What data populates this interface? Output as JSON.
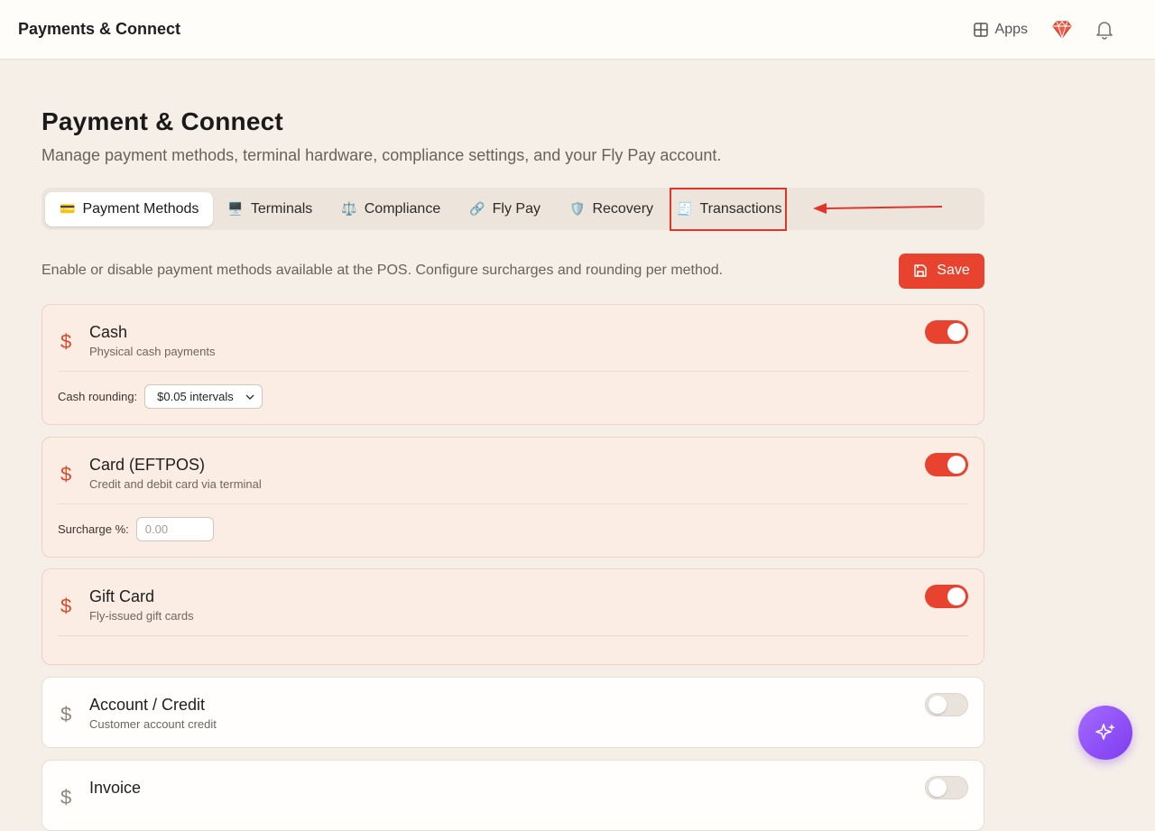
{
  "header": {
    "title": "Payments & Connect",
    "apps_label": "Apps"
  },
  "page": {
    "title": "Payment & Connect",
    "subtitle": "Manage payment methods, terminal hardware, compliance settings, and your Fly Pay account."
  },
  "tabs": [
    {
      "label": "Payment Methods",
      "emoji": "💳",
      "active": true
    },
    {
      "label": "Terminals",
      "emoji": "🖥️",
      "active": false
    },
    {
      "label": "Compliance",
      "emoji": "⚖️",
      "active": false
    },
    {
      "label": "Fly Pay",
      "emoji": "🔗",
      "active": false
    },
    {
      "label": "Recovery",
      "emoji": "🛡️",
      "active": false
    },
    {
      "label": "Transactions",
      "emoji": "🧾",
      "active": false
    }
  ],
  "intro": {
    "text": "Enable or disable payment methods available at the POS. Configure surcharges and rounding per method.",
    "save_label": "Save"
  },
  "methods": [
    {
      "name": "Cash",
      "description": "Physical cash payments",
      "enabled": true,
      "setting_label": "Cash rounding:",
      "setting_value": "$0.05 intervals"
    },
    {
      "name": "Card (EFTPOS)",
      "description": "Credit and debit card via terminal",
      "enabled": true,
      "setting_label": "Surcharge %:",
      "setting_placeholder": "0.00"
    },
    {
      "name": "Gift Card",
      "description": "Fly-issued gift cards",
      "enabled": true
    },
    {
      "name": "Account / Credit",
      "description": "Customer account credit",
      "enabled": false
    },
    {
      "name": "Invoice",
      "description": "",
      "enabled": false
    }
  ],
  "colors": {
    "accent": "#e8432f",
    "background": "#f6efe8",
    "fab_purple": "#8f4cf5"
  },
  "icons": {
    "method": "dollar-sign-icon",
    "apps": "grid-icon",
    "gem": "gem-icon",
    "bell": "bell-icon",
    "save": "floppy-disk-icon",
    "fab": "sparkles-icon"
  }
}
